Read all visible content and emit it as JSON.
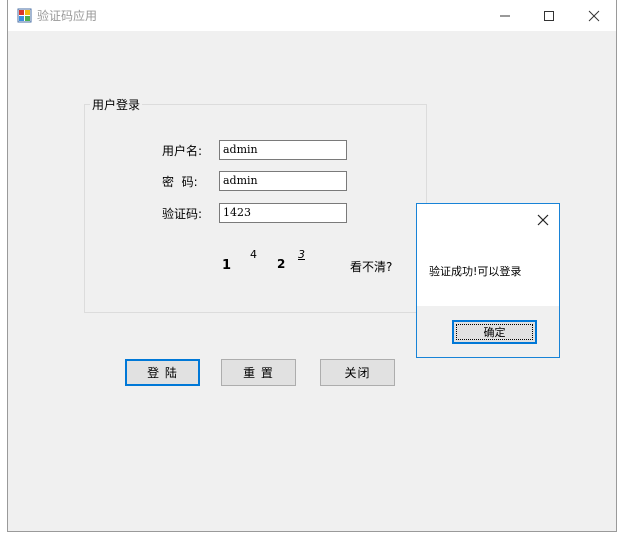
{
  "window": {
    "title": "验证码应用"
  },
  "login_group": {
    "legend": "用户登录",
    "username_label": "用户名:",
    "password_label": "密  码:",
    "captcha_label": "验证码:",
    "username_value": "admin",
    "password_value": "admin",
    "captcha_value": "1423"
  },
  "captcha_image": {
    "chars": [
      "1",
      "4",
      "2",
      "3"
    ]
  },
  "unclear_link": "看不清?",
  "buttons": {
    "login": "登 陆",
    "reset": "重 置",
    "close": "关闭"
  },
  "dialog": {
    "message": "验证成功!可以登录",
    "ok": "确定"
  },
  "colors": {
    "accent": "#0078d7",
    "window_bg": "#f0f0f0"
  }
}
